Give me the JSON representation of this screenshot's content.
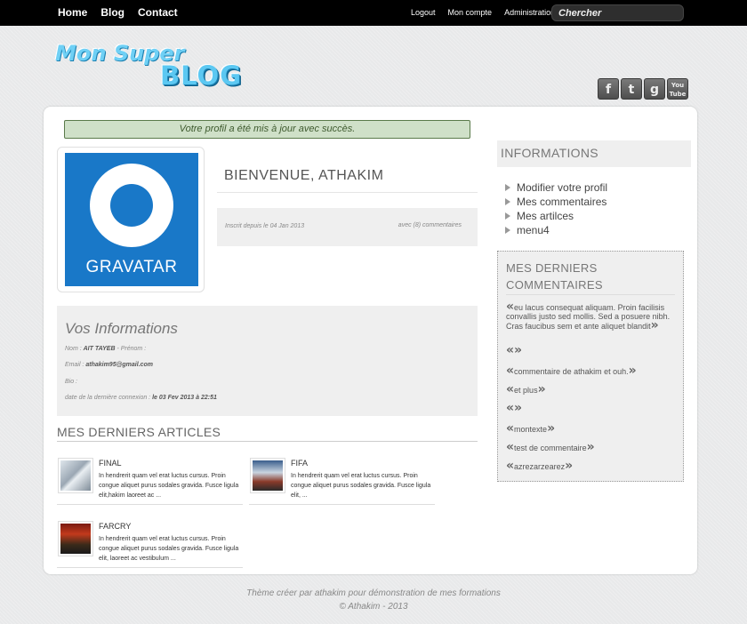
{
  "topbar": {
    "nav": [
      "Home",
      "Blog",
      "Contact"
    ],
    "user_links": [
      "Logout",
      "Mon compte",
      "Administration"
    ],
    "search_placeholder": "Chercher"
  },
  "logo": {
    "line1": "Mon Super",
    "line2": "BLOG"
  },
  "social": [
    {
      "name": "facebook-icon",
      "glyph": "f"
    },
    {
      "name": "twitter-icon",
      "glyph": "t"
    },
    {
      "name": "google-icon",
      "glyph": "g"
    },
    {
      "name": "youtube-icon",
      "glyph": "You Tube"
    }
  ],
  "flash": "Votre profil a été mis à jour avec succès.",
  "avatar": {
    "word": "GRAVATAR",
    "color": "#1978c8"
  },
  "welcome": {
    "title": "BIENVENUE, ATHAKIM",
    "since": "Inscrit depuis le 04 Jan 2013",
    "comment_count": "avec (8) commentaires"
  },
  "info": {
    "title": "Vos Informations",
    "nom_label": "Nom : ",
    "nom_value": "AIT TAYEB",
    "prenom_label": " - Prénom :",
    "email_label": "Email : ",
    "email_value": "athakim95@gmail.com",
    "bio_label": "Bio :",
    "last_label": "date de la dernière connexion : ",
    "last_value": "le 03 Fev 2013 à 22:51"
  },
  "articles": {
    "title": "MES DERNIERS ARTICLES",
    "items": [
      {
        "title": "FINAL",
        "text": "In hendrerit quam vel erat luctus cursus. Proin congue aliquet purus sodales gravida. Fusce ligula elit,hakim laoreet ac ..."
      },
      {
        "title": "FIFA",
        "text": "In hendrerit quam vel erat luctus cursus. Proin congue aliquet purus sodales gravida. Fusce ligula elit, ..."
      },
      {
        "title": "FARCRY",
        "text": "In hendrerit quam vel erat luctus cursus. Proin congue aliquet purus sodales gravida. Fusce ligula elit, laoreet ac vestibulum  ..."
      }
    ]
  },
  "sidebar": {
    "info_title": "INFORMATIONS",
    "menu": [
      "Modifier votre profil",
      "Mes commentaires",
      "Mes artilces",
      "menu4"
    ],
    "comments_title": "MES DERNIERS COMMENTAIRES",
    "comments": [
      "eu lacus consequat aliquam. Proin facilisis convallis justo sed mollis. Sed a posuere nibh. Cras faucibus sem et ante aliquet blandit",
      "",
      "commentaire de athakim et ouh.",
      "et plus",
      "",
      "montexte",
      "test de commentaire",
      "azrezarzearez"
    ]
  },
  "footer": {
    "line1": "Thème créer par athakim pour démonstration de mes formations",
    "line2": "© Athakim - 2013"
  }
}
